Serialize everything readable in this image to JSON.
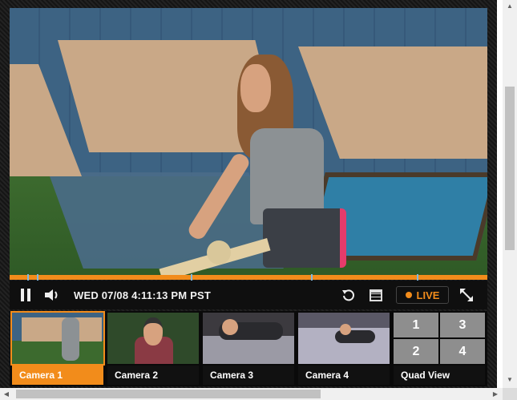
{
  "player": {
    "timestamp": "WED 07/08 4:11:13 PM PST",
    "live_label": "LIVE",
    "progress": 1.0
  },
  "icons": {
    "pause": "pause-icon",
    "volume": "volume-icon",
    "replay": "replay-icon",
    "calendar": "calendar-icon",
    "live": "live-dot-icon",
    "fullscreen": "fullscreen-icon"
  },
  "cameras": [
    {
      "label": "Camera 1",
      "active": true
    },
    {
      "label": "Camera 2",
      "active": false
    },
    {
      "label": "Camera 3",
      "active": false
    },
    {
      "label": "Camera 4",
      "active": false
    }
  ],
  "quad": {
    "label": "Quad View",
    "cells": [
      "1",
      "3",
      "2",
      "4"
    ]
  },
  "colors": {
    "accent": "#f28c1b",
    "bar_bg": "#0f0f0f",
    "marker": "#7fb8e0"
  }
}
